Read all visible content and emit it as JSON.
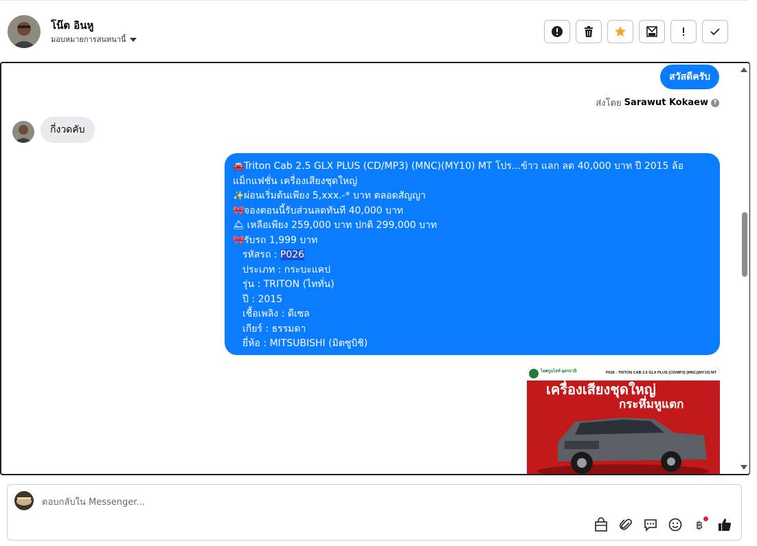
{
  "header": {
    "contact_name": "โน๊ต อินหู",
    "assign_label": "มอบหมายการสนทนานี้",
    "actions": [
      "alert-circle-icon",
      "trash-icon",
      "star-icon",
      "mail-icon",
      "exclamation-icon",
      "check-icon"
    ],
    "star_color": "#f5a623"
  },
  "chat": {
    "outgoing_greeting": "สวัสดีครับ",
    "sent_by_prefix": "ส่งโดย",
    "sent_by_name": "Sarawut Kokaew",
    "incoming_message": "กี่งวดคับ",
    "listing": {
      "title_line1": "Triton Cab 2.5 GLX PLUS (CD/MP3) (MNC)(MY10) MT โปร...ข้าว แลก ลด 40,000 บาท ปี 2015 ล้อ",
      "title_line2": "แม็กแฟชั่น เครื่องเสียงชุดใหญ่",
      "promo1": "ผ่อนเริ่มต้นเพียง 5,xxx.-* บาท ตลอดสัญญา",
      "promo2": "จองตอนนี้รับส่วนลดทันที 40,000 บาท",
      "promo3": " เหลือเพียง 259,000 บาท ปกติ  299,000 บาท",
      "promo4": "รับรถ 1,999 บาท",
      "code_label": "รหัสรถ : ",
      "code_value": "P026",
      "type": "ประเภท : กระบะแคป",
      "model": "รุ่น : TRITON (ไททั่น)",
      "year": "ปี : 2015",
      "fuel": "เชื้อเพลิง : ดีเซล",
      "gear": "เกียร์ : ธรรมดา",
      "brand": "ยี่ห้อ : MITSUBISHI (มิตซูบิชิ)"
    },
    "image": {
      "dealer": "ไอศกูนไลท์ อุดรธานี",
      "banner_top": "P026 - TRITON CAB 2.5 GLX PLUS (CD/MP3) (MNC)(MY10) MT",
      "headline1": "เครื่องเสียงชุดใหญ่",
      "headline2": "กระหึ่มหูแตก"
    }
  },
  "composer": {
    "placeholder": "ตอบกลับใน Messenger...",
    "icons": [
      "bag-icon",
      "paperclip-icon",
      "speech-bubble-icon",
      "emoji-icon",
      "baht-icon",
      "thumbs-up-icon"
    ]
  },
  "colors": {
    "messenger_blue": "#0a7cff",
    "incoming_gray": "#e9eaed"
  }
}
